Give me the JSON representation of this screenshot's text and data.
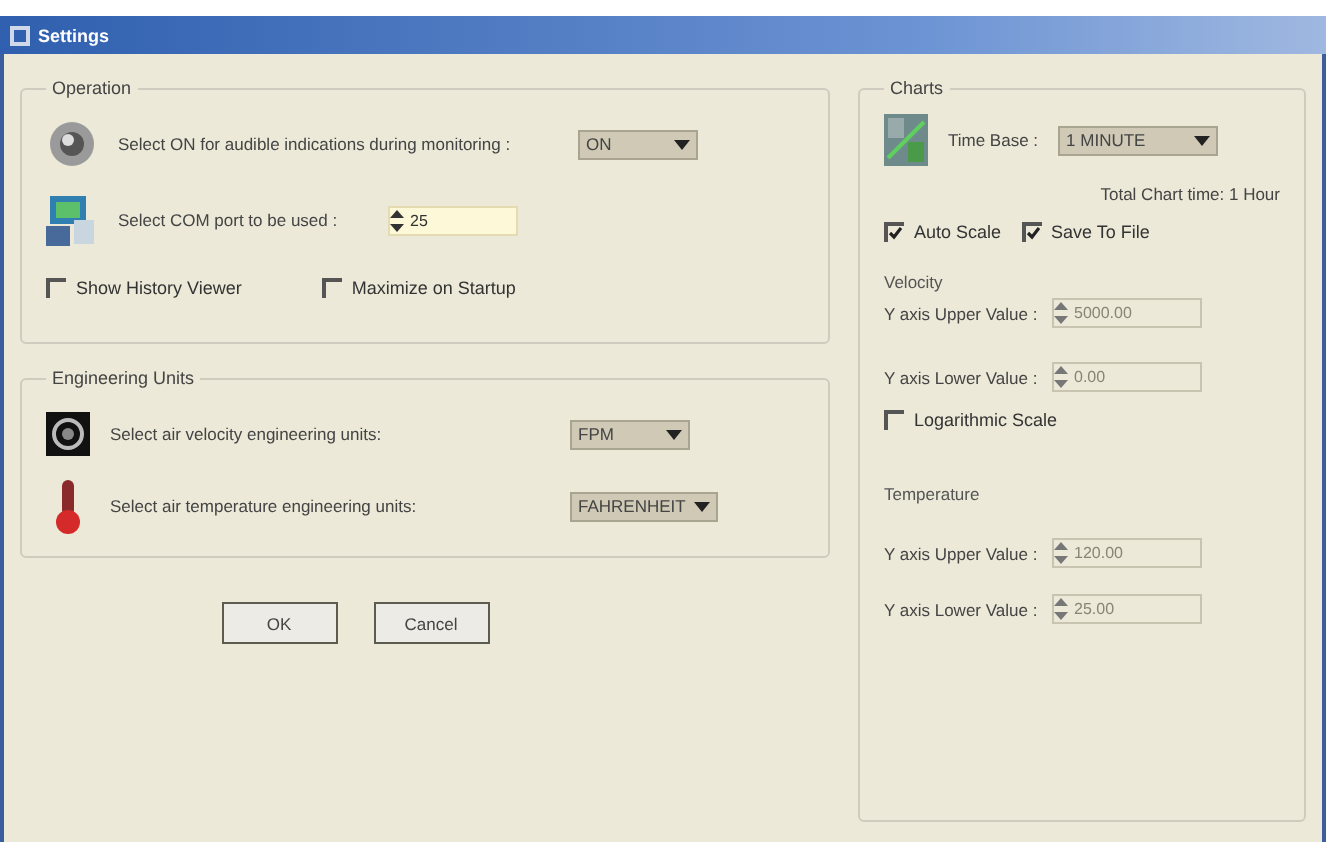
{
  "window": {
    "title": "Settings"
  },
  "operation": {
    "title": "Operation",
    "rows": [
      {
        "kind": "dropdown",
        "label": "Select ON for audible indications during monitoring :",
        "value": "ON"
      },
      {
        "kind": "spin",
        "label": "Select COM port to be used :",
        "value": "25",
        "disabled": false
      }
    ],
    "checkboxes": [
      {
        "label": "Show History Viewer",
        "checked": false
      },
      {
        "label": "Maximize on Startup",
        "checked": false
      }
    ]
  },
  "engineering_units": {
    "title": "Engineering Units",
    "rows": [
      {
        "kind": "dropdown",
        "label": "Select air velocity engineering units:",
        "value": "FPM"
      },
      {
        "kind": "dropdown",
        "label": "Select air temperature engineering units:",
        "value": "FAHRENHEIT"
      }
    ]
  },
  "buttons": [
    {
      "label": "OK"
    },
    {
      "label": "Cancel"
    }
  ],
  "charts": {
    "title": "Charts",
    "time_base": {
      "label": "Time Base :",
      "value": "1 MINUTE"
    },
    "total_chart_time": "Total Chart time: 1 Hour",
    "checkboxes": [
      {
        "label": "Auto Scale",
        "checked": true
      },
      {
        "label": "Save To File",
        "checked": true
      }
    ],
    "velocity": {
      "title": "Velocity",
      "fields": [
        {
          "label": "Y axis Upper Value :",
          "value": "5000.00",
          "disabled": true
        },
        {
          "label": "Y axis Lower Value :",
          "value": "0.00",
          "disabled": true
        }
      ],
      "logarithmic": {
        "label": "Logarithmic Scale",
        "checked": false
      }
    },
    "temperature": {
      "title": "Temperature",
      "fields": [
        {
          "label": "Y axis Upper Value :",
          "value": "120.00",
          "disabled": true
        },
        {
          "label": "Y axis Lower Value :",
          "value": "25.00",
          "disabled": true
        }
      ]
    }
  }
}
